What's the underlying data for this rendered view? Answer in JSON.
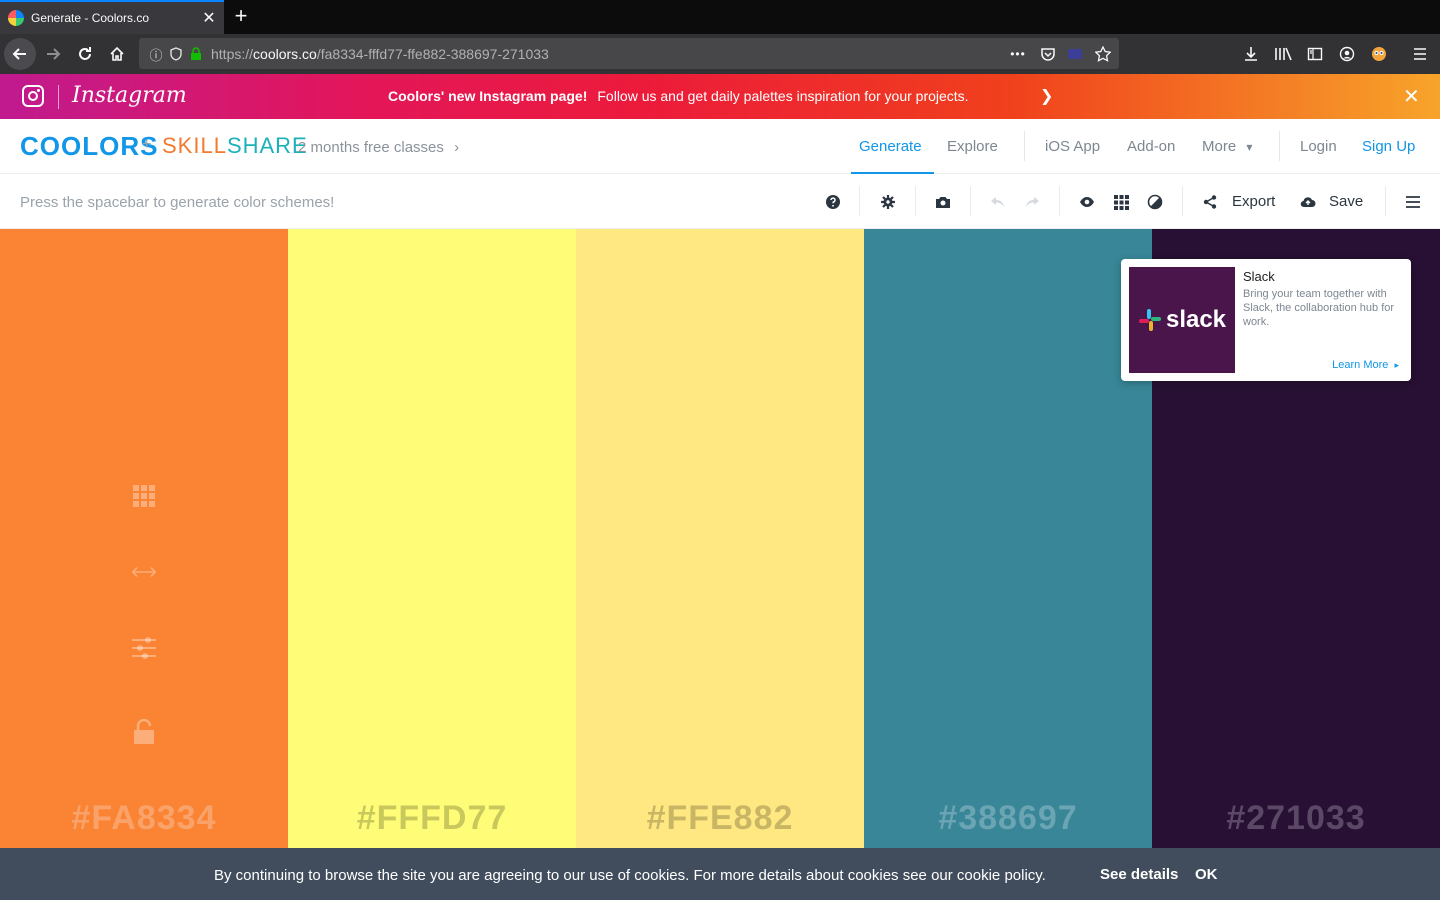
{
  "browser": {
    "tab_title": "Generate - Coolors.co",
    "tab_close": "✕",
    "new_tab": "+",
    "url_prefix": "https://",
    "url_host": "coolors.co",
    "url_path": "/fa8334-fffd77-ffe882-388697-271033",
    "url_more": "•••"
  },
  "promo": {
    "brand": "Instagram",
    "headline": "Coolors' new Instagram page!",
    "text": "Follow us and get daily palettes inspiration for your projects.",
    "arrow": "❯",
    "close": "✕"
  },
  "header": {
    "logo": "COOLORS",
    "plus": "+",
    "partner_a": "SKILL",
    "partner_b": "SHARE",
    "partner_offer": "2 months free classes",
    "partner_chevron": "›",
    "nav": {
      "generate": "Generate",
      "explore": "Explore",
      "ios": "iOS App",
      "addon": "Add-on",
      "more": "More",
      "more_chevron": "▾",
      "login": "Login",
      "signup": "Sign Up"
    }
  },
  "toolbar": {
    "hint": "Press the spacebar to generate color schemes!",
    "export_label": "Export",
    "save_label": "Save"
  },
  "palette": {
    "swatches": [
      {
        "hex": "#FA8334",
        "bg": "#FA8334",
        "text_color": "#F9A36A"
      },
      {
        "hex": "#FFFD77",
        "bg": "#FFFD77",
        "text_color": "#C8C85D"
      },
      {
        "hex": "#FFE882",
        "bg": "#FFE882",
        "text_color": "#C8B665"
      },
      {
        "hex": "#388697",
        "bg": "#388697",
        "text_color": "#6BA4B2"
      },
      {
        "hex": "#271033",
        "bg": "#271033",
        "text_color": "#5B4866"
      }
    ]
  },
  "ad": {
    "logo_word": "slack",
    "title": "Slack",
    "body": "Bring your team together with Slack, the collaboration hub for work.",
    "cta": "Learn More",
    "cta_arrow": "▸"
  },
  "cookie": {
    "text": "By continuing to browse the site you are agreeing to our use of cookies. For more details about cookies see our cookie policy.",
    "details": "See details",
    "ok": "OK"
  },
  "colors": {
    "accent": "#1196e8",
    "skillshare_orange": "#f37a2e",
    "skillshare_teal": "#1cb1ba",
    "cookie_bg": "#414c5c",
    "slack_purple": "#4a154b"
  }
}
